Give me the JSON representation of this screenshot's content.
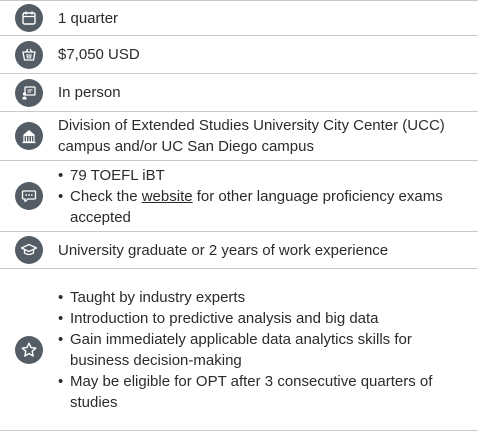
{
  "colors": {
    "icon_bg": "#545d66",
    "divider": "#c9c9c9",
    "text": "#2b2b2b"
  },
  "rows": [
    {
      "icon": "calendar-icon",
      "text": "1 quarter"
    },
    {
      "icon": "shopping-basket-icon",
      "text": "$7,050 USD"
    },
    {
      "icon": "presentation-board-icon",
      "text": "In person"
    },
    {
      "icon": "campus-building-icon",
      "text": "Division of Extended Studies University City Center (UCC) campus and/or UC San Diego campus"
    },
    {
      "icon": "chat-bubble-icon",
      "bullet1": "79 TOEFL iBT",
      "bullet2_before": "Check the ",
      "bullet2_link": "website",
      "bullet2_after": " for other language proficiency exams accepted"
    },
    {
      "icon": "graduation-cap-icon",
      "text": "University graduate or 2 years of work experience"
    },
    {
      "icon": "star-icon",
      "bullets": [
        "Taught by industry experts",
        "Introduction to predictive analysis and big data",
        "Gain immediately applicable data analytics skills for business decision-making",
        "May be eligible for OPT after 3 consecutive quarters of studies"
      ]
    }
  ]
}
